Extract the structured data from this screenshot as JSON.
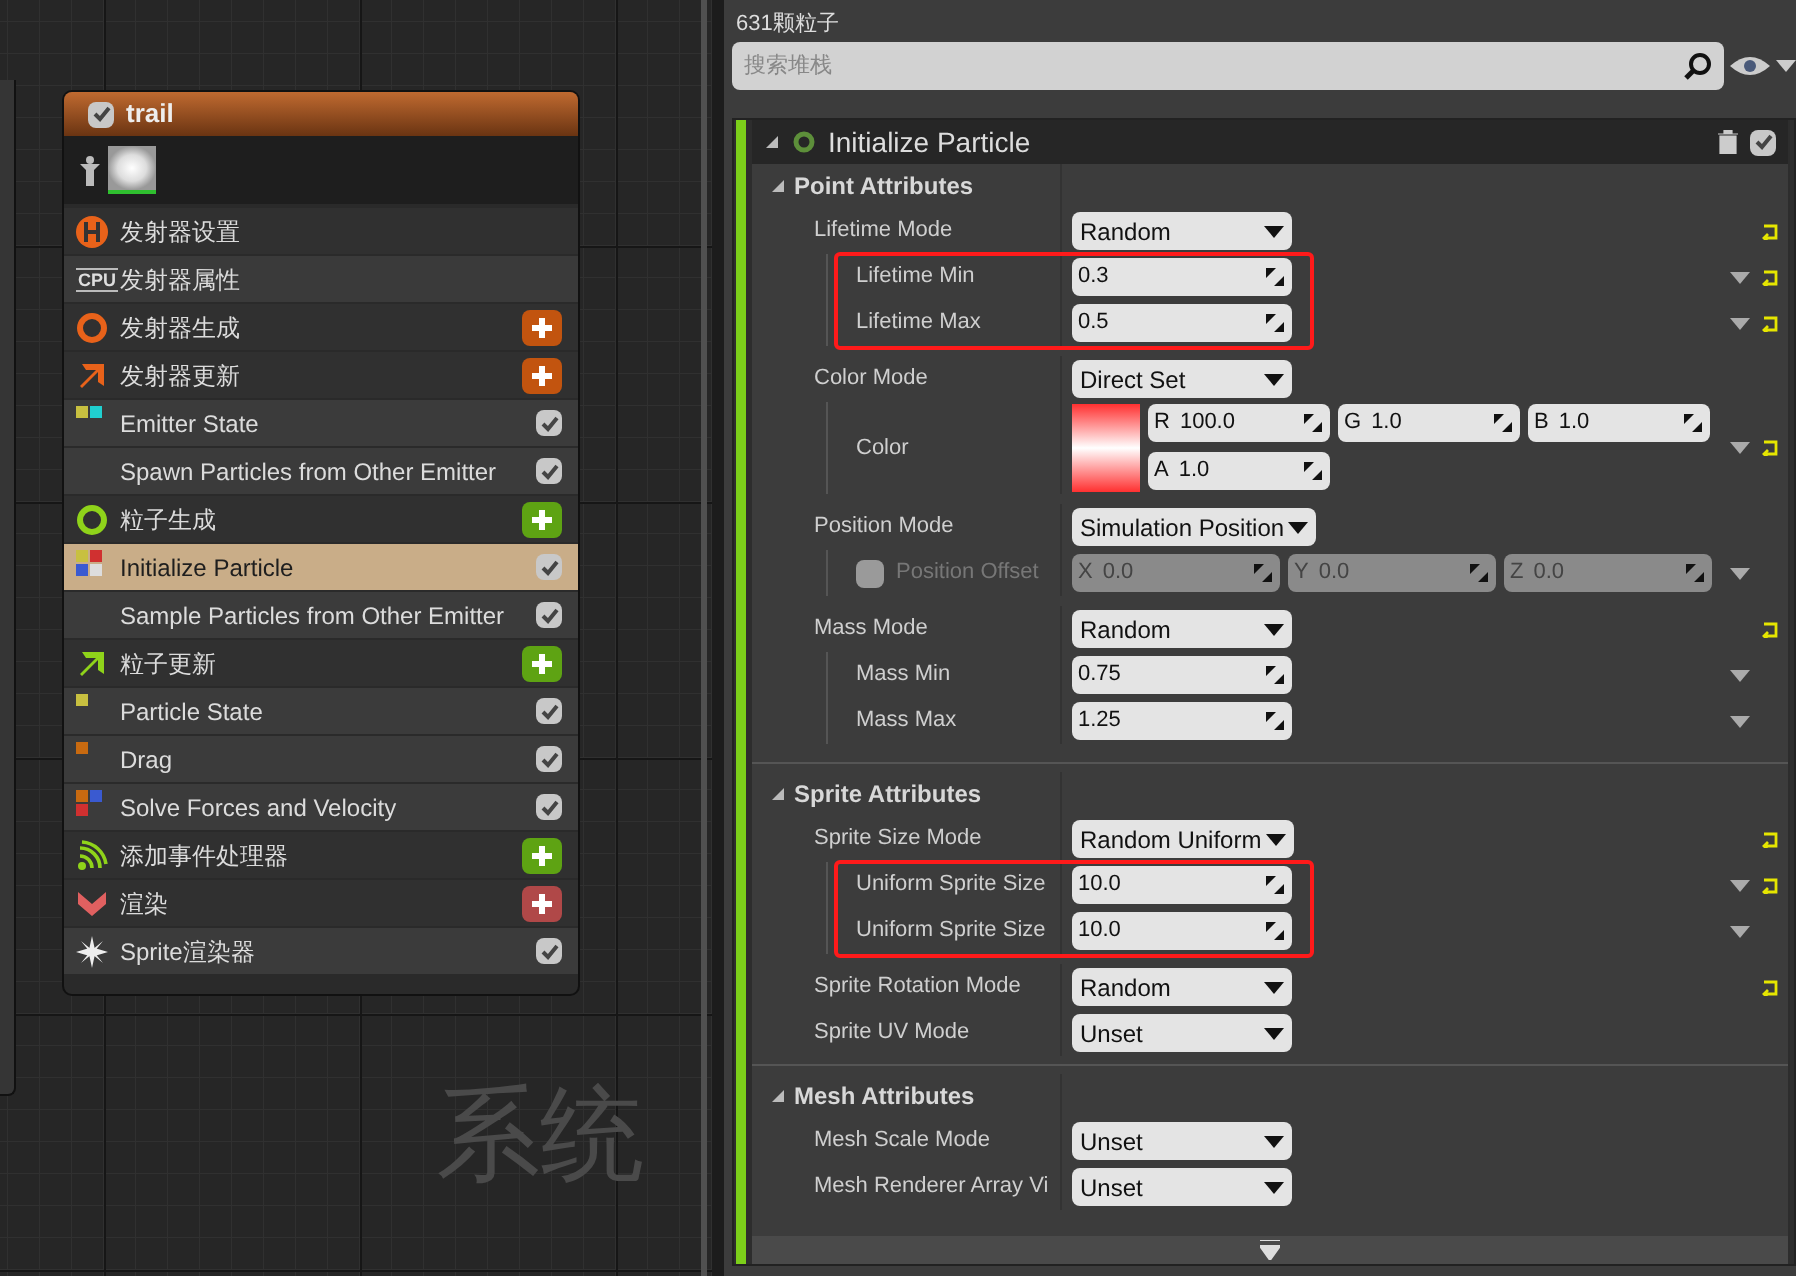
{
  "canvas": {
    "label": "系统"
  },
  "node": {
    "title": "trail",
    "enabled": true,
    "items": [
      {
        "kind": "stage",
        "label": "发射器设置",
        "selected": false
      },
      {
        "kind": "properties",
        "badge": "CPU",
        "label": "发射器属性",
        "selected": false
      },
      {
        "kind": "stage",
        "label": "发射器生成",
        "color": "#c2540f",
        "selected": false
      },
      {
        "kind": "stage",
        "label": "发射器更新",
        "color": "#c2540f",
        "selected": false
      },
      {
        "kind": "module",
        "label": "Emitter State",
        "dots": [
          {
            "color": "#c8c040"
          },
          {
            "color": "#20d0d0"
          }
        ],
        "enabled": true,
        "selected": false
      },
      {
        "kind": "module",
        "label": "Spawn Particles from Other Emitter",
        "enabled": true,
        "selected": false
      },
      {
        "kind": "stage",
        "label": "粒子生成",
        "color": "#5ea313",
        "selected": false
      },
      {
        "kind": "module",
        "label": "Initialize Particle",
        "dots": [
          {
            "color": "#c8c040"
          },
          {
            "color": "#d03030"
          },
          {
            "color": "#3a5ad0"
          },
          {
            "color": "#dddddd"
          }
        ],
        "enabled": true,
        "selected": true
      },
      {
        "kind": "module",
        "label": "Sample Particles from Other Emitter",
        "enabled": true,
        "selected": false
      },
      {
        "kind": "stage",
        "label": "粒子更新",
        "color": "#5ea313",
        "selected": false
      },
      {
        "kind": "module",
        "label": "Particle State",
        "dots": [
          {
            "color": "#c8c040"
          }
        ],
        "enabled": true,
        "selected": false
      },
      {
        "kind": "module",
        "label": "Drag",
        "dots": [
          {
            "color": "#c86a10"
          }
        ],
        "enabled": true,
        "selected": false
      },
      {
        "kind": "module",
        "label": "Solve Forces and Velocity",
        "dots": [
          {
            "color": "#c86a10"
          },
          {
            "color": "#3a5ad0"
          },
          {
            "color": "#d03030"
          }
        ],
        "enabled": true,
        "selected": false
      },
      {
        "kind": "stage",
        "label": "添加事件处理器",
        "color": "#5ea313",
        "selected": false
      },
      {
        "kind": "stage",
        "label": "渲染",
        "color": "#b04848",
        "selected": false
      },
      {
        "kind": "module",
        "label": "Sprite渲染器",
        "enabled": true,
        "selected": false
      }
    ]
  },
  "panel": {
    "particle_count": "631颗粒子",
    "search": {
      "placeholder": "搜索堆栈"
    },
    "module": {
      "title": "Initialize Particle",
      "enabled": true,
      "sections": [
        {
          "title": "Point Attributes",
          "expanded": true,
          "rows": [
            {
              "kind": "dropdown",
              "label": "Lifetime Mode",
              "value": "Random",
              "reset": true,
              "highlighted": true,
              "children": [
                {
                  "kind": "number",
                  "label": "Lifetime Min",
                  "value": "0.3",
                  "menu": true,
                  "reset": true
                },
                {
                  "kind": "number",
                  "label": "Lifetime Max",
                  "value": "0.5",
                  "menu": true,
                  "reset": true
                }
              ]
            },
            {
              "kind": "dropdown",
              "label": "Color Mode",
              "value": "Direct Set",
              "highlighted": false,
              "children": [
                {
                  "kind": "color",
                  "label": "Color",
                  "fields": [
                    {
                      "axis": "R",
                      "value": "100.0"
                    },
                    {
                      "axis": "G",
                      "value": "1.0"
                    },
                    {
                      "axis": "B",
                      "value": "1.0"
                    },
                    {
                      "axis": "A",
                      "value": "1.0"
                    }
                  ],
                  "menu": true,
                  "reset": true
                }
              ]
            },
            {
              "kind": "dropdown",
              "label": "Position Mode",
              "value": "Simulation Position",
              "highlighted": false,
              "children": [
                {
                  "kind": "vector",
                  "label": "Position Offset",
                  "enabled": false,
                  "fields": [
                    {
                      "axis": "X",
                      "value": "0.0"
                    },
                    {
                      "axis": "Y",
                      "value": "0.0"
                    },
                    {
                      "axis": "Z",
                      "value": "0.0"
                    }
                  ],
                  "menu": true
                }
              ]
            },
            {
              "kind": "dropdown",
              "label": "Mass Mode",
              "value": "Random",
              "reset": true,
              "highlighted": false,
              "children": [
                {
                  "kind": "number",
                  "label": "Mass Min",
                  "value": "0.75",
                  "menu": true
                },
                {
                  "kind": "number",
                  "label": "Mass Max",
                  "value": "1.25",
                  "menu": true
                }
              ]
            }
          ]
        },
        {
          "title": "Sprite Attributes",
          "expanded": true,
          "rows": [
            {
              "kind": "dropdown",
              "label": "Sprite Size Mode",
              "value": "Random Uniform",
              "reset": true,
              "highlighted": true,
              "children": [
                {
                  "kind": "number",
                  "label": "Uniform Sprite Size",
                  "value": "10.0",
                  "menu": true,
                  "reset": true
                },
                {
                  "kind": "number",
                  "label": "Uniform Sprite Size",
                  "value": "10.0",
                  "menu": true
                }
              ]
            },
            {
              "kind": "dropdown",
              "label": "Sprite Rotation Mode",
              "value": "Random",
              "reset": true
            },
            {
              "kind": "dropdown",
              "label": "Sprite UV Mode",
              "value": "Unset"
            }
          ]
        },
        {
          "title": "Mesh Attributes",
          "expanded": true,
          "rows": [
            {
              "kind": "dropdown",
              "label": "Mesh Scale Mode",
              "value": "Unset"
            },
            {
              "kind": "dropdown",
              "label": "Mesh Renderer Array Vi",
              "value": "Unset"
            }
          ]
        }
      ]
    }
  }
}
